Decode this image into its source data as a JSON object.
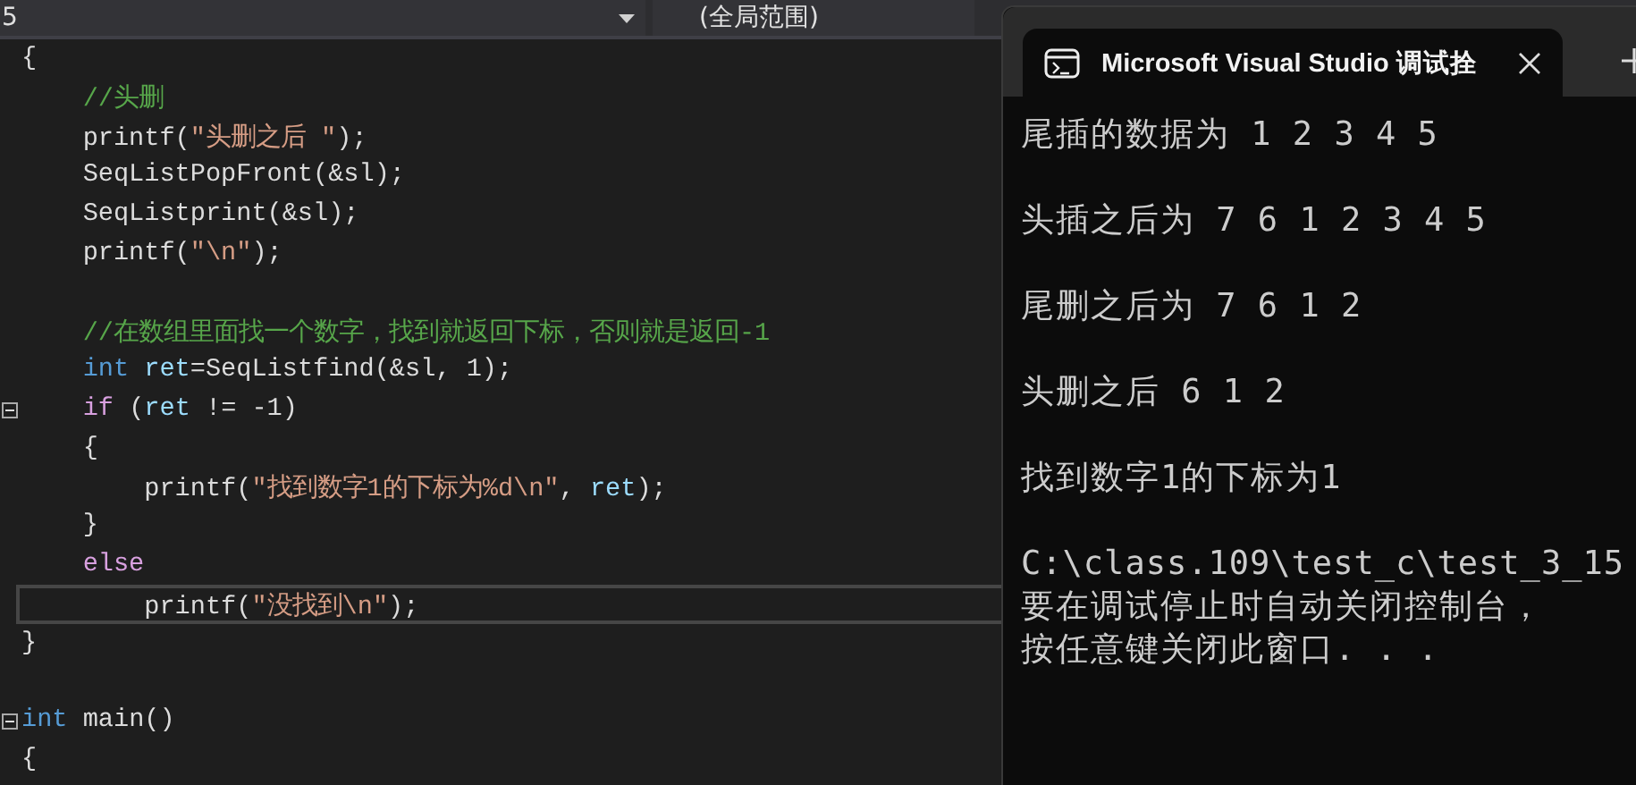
{
  "editor": {
    "member_dropdown": {
      "value": "5"
    },
    "scope_dropdown": {
      "value": "(全局范围)"
    },
    "lines": [
      {
        "collapsible": false,
        "current": false,
        "gap_before": false,
        "tokens": [
          {
            "kind": "plain",
            "text": "{"
          }
        ]
      },
      {
        "collapsible": false,
        "current": false,
        "gap_before": false,
        "tokens": [
          {
            "kind": "comment",
            "text": "    //头删"
          }
        ]
      },
      {
        "collapsible": false,
        "current": false,
        "gap_before": false,
        "tokens": [
          {
            "kind": "plain",
            "text": "    printf("
          },
          {
            "kind": "string",
            "text": "\"头删之后 \""
          },
          {
            "kind": "plain",
            "text": ");"
          }
        ]
      },
      {
        "collapsible": false,
        "current": false,
        "gap_before": false,
        "tokens": [
          {
            "kind": "plain",
            "text": "    SeqListPopFront(&sl);"
          }
        ]
      },
      {
        "collapsible": false,
        "current": false,
        "gap_before": false,
        "tokens": [
          {
            "kind": "plain",
            "text": "    SeqListprint(&sl);"
          }
        ]
      },
      {
        "collapsible": false,
        "current": false,
        "gap_before": false,
        "tokens": [
          {
            "kind": "plain",
            "text": "    printf("
          },
          {
            "kind": "string",
            "text": "\"\\n\""
          },
          {
            "kind": "plain",
            "text": ");"
          }
        ]
      },
      {
        "collapsible": false,
        "current": false,
        "gap_before": true,
        "tokens": [
          {
            "kind": "comment",
            "text": "    //在数组里面找一个数字，找到就返回下标，否则就是返回-1"
          }
        ]
      },
      {
        "collapsible": false,
        "current": false,
        "gap_before": false,
        "tokens": [
          {
            "kind": "keyword",
            "text": "    int"
          },
          {
            "kind": "variable",
            "text": " ret"
          },
          {
            "kind": "plain",
            "text": "=SeqListfind(&sl, 1);"
          }
        ]
      },
      {
        "collapsible": true,
        "current": false,
        "gap_before": false,
        "tokens": [
          {
            "kind": "control",
            "text": "    if"
          },
          {
            "kind": "plain",
            "text": " ("
          },
          {
            "kind": "variable",
            "text": "ret"
          },
          {
            "kind": "plain",
            "text": " != -1)"
          }
        ]
      },
      {
        "collapsible": false,
        "current": false,
        "gap_before": false,
        "tokens": [
          {
            "kind": "plain",
            "text": "    {"
          }
        ]
      },
      {
        "collapsible": false,
        "current": false,
        "gap_before": false,
        "tokens": [
          {
            "kind": "plain",
            "text": "        printf("
          },
          {
            "kind": "string",
            "text": "\"找到数字1的下标为%d\\n\""
          },
          {
            "kind": "plain",
            "text": ", "
          },
          {
            "kind": "variable",
            "text": "ret"
          },
          {
            "kind": "plain",
            "text": ");"
          }
        ]
      },
      {
        "collapsible": false,
        "current": false,
        "gap_before": false,
        "tokens": [
          {
            "kind": "plain",
            "text": "    }"
          }
        ]
      },
      {
        "collapsible": false,
        "current": false,
        "gap_before": false,
        "tokens": [
          {
            "kind": "control",
            "text": "    else"
          }
        ]
      },
      {
        "collapsible": false,
        "current": true,
        "gap_before": false,
        "tokens": [
          {
            "kind": "plain",
            "text": "        printf("
          },
          {
            "kind": "string",
            "text": "\"没找到\\n\""
          },
          {
            "kind": "plain",
            "text": ");"
          }
        ]
      },
      {
        "collapsible": false,
        "current": false,
        "gap_before": false,
        "tokens": [
          {
            "kind": "plain",
            "text": "}"
          }
        ]
      },
      {
        "collapsible": true,
        "current": false,
        "gap_before": true,
        "tokens": [
          {
            "kind": "keyword",
            "text": "int"
          },
          {
            "kind": "plain",
            "text": " main()"
          }
        ]
      },
      {
        "collapsible": false,
        "current": false,
        "gap_before": false,
        "tokens": [
          {
            "kind": "plain",
            "text": "{"
          }
        ]
      }
    ]
  },
  "terminal": {
    "tab": {
      "title": "Microsoft Visual Studio 调试拴"
    },
    "output": [
      [
        "尾插的数据为 1 2 3 4 5"
      ],
      [
        "头插之后为 7 6 1 2 3 4 5"
      ],
      [
        "尾删之后为 7 6 1 2"
      ],
      [
        "头删之后 6 1 2"
      ],
      [
        "找到数字1的下标为1"
      ],
      [
        "C:\\class.109\\test_c\\test_3_15",
        "要在调试停止时自动关闭控制台，",
        "按任意键关闭此窗口. . ."
      ]
    ]
  }
}
